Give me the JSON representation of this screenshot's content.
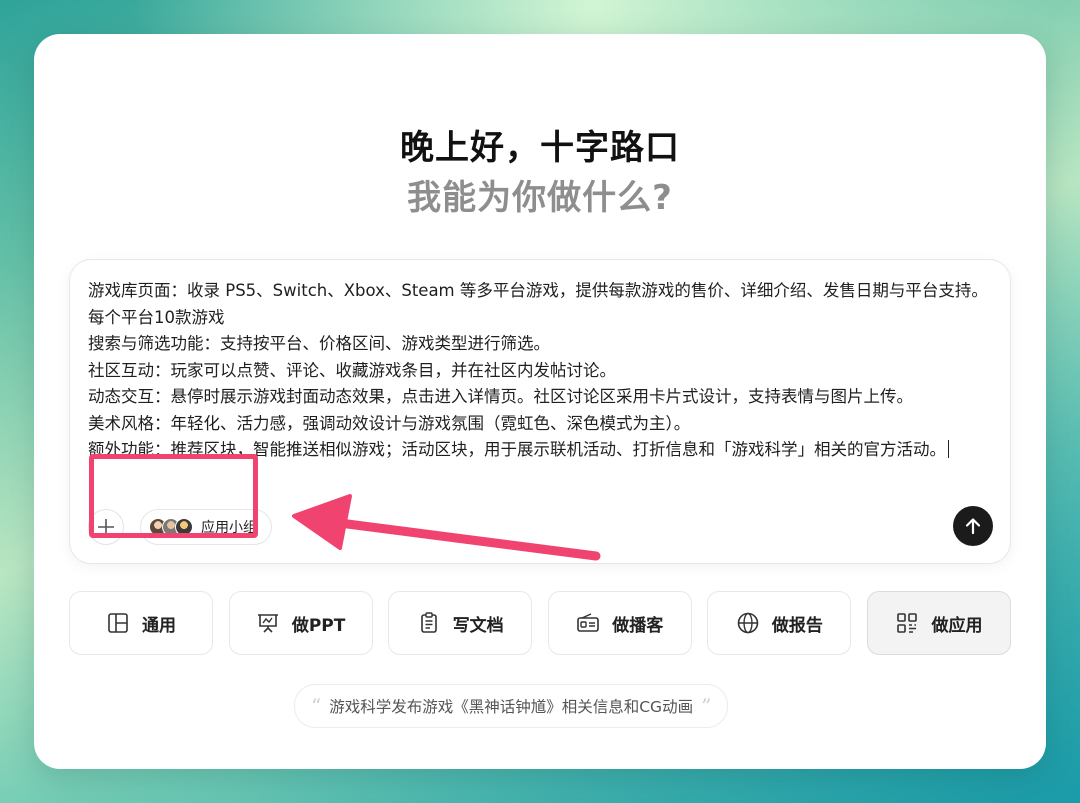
{
  "header": {
    "greeting": "晚上好，十字路口",
    "subgreeting": "我能为你做什么?"
  },
  "composer": {
    "lines": [
      "游戏库页面：收录 PS5、Switch、Xbox、Steam 等多平台游戏，提供每款游戏的售价、详细介绍、发售日期与平台支持。每个平台10款游戏",
      "搜索与筛选功能：支持按平台、价格区间、游戏类型进行筛选。",
      "社区互动：玩家可以点赞、评论、收藏游戏条目，并在社区内发帖讨论。",
      "动态交互：悬停时展示游戏封面动态效果，点击进入详情页。社区讨论区采用卡片式设计，支持表情与图片上传。",
      "美术风格：年轻化、活力感，强调动效设计与游戏氛围（霓虹色、深色模式为主）。",
      "额外功能：推荐区块，智能推送相似游戏；活动区块，用于展示联机活动、打折信息和「游戏科学」相关的官方活动。"
    ],
    "add_icon": "plus-icon",
    "group_chip_label": "应用小组",
    "send_icon": "arrow-up-icon"
  },
  "modes": [
    {
      "label": "通用",
      "icon": "layout-icon",
      "active": false
    },
    {
      "label": "做PPT",
      "icon": "presentation-icon",
      "active": false
    },
    {
      "label": "写文档",
      "icon": "clipboard-icon",
      "active": false
    },
    {
      "label": "做播客",
      "icon": "radio-icon",
      "active": false
    },
    {
      "label": "做报告",
      "icon": "globe-icon",
      "active": false
    },
    {
      "label": "做应用",
      "icon": "apps-grid-icon",
      "active": true
    }
  ],
  "suggestion": {
    "open_quote": "“",
    "text": "游戏科学发布游戏《黑神话钟馗》相关信息和CG动画",
    "close_quote": "”"
  },
  "colors": {
    "highlight": "#f0436f",
    "send_button": "#1b1b1b"
  }
}
